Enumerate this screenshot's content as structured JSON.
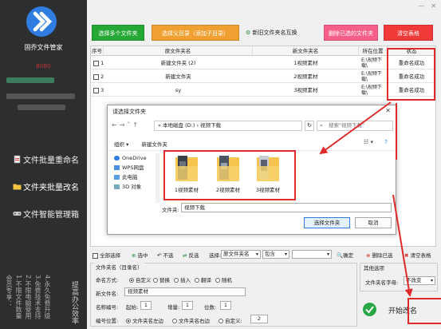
{
  "app": {
    "name": "固乔文件管家",
    "edition": "B0B0",
    "window_controls": [
      "—",
      "✕"
    ]
  },
  "sidebar": {
    "items": [
      {
        "label": "文件批量重命名",
        "icon": "document-icon"
      },
      {
        "label": "文件夹批量改名",
        "icon": "folder-icon"
      },
      {
        "label": "文件智能管理箱",
        "icon": "gamepad-icon"
      }
    ],
    "vertical_texts": [
      "会员专享：",
      "1.不限文件数量",
      "2.不限电脑使用",
      "3.免费技术支持",
      "4.永久免费升级",
      "提高办公效率"
    ]
  },
  "toolbar": {
    "add_folders": "选择多个文件夹",
    "add_parent": "选择父目录（添加子目录）",
    "new_name_swap": "新旧文件夹名互换",
    "delete_selected": "删除已选的文件夹",
    "clear_table": "清空表格",
    "colors": {
      "green": "#25a835",
      "orange": "#f0a030",
      "pink": "#f65f8a",
      "red": "#f03a3a"
    }
  },
  "grid": {
    "columns": [
      "序号",
      "原文件夹名",
      "新文件夹名",
      "所在位置",
      "状态"
    ],
    "rows": [
      {
        "index": "1",
        "original": "新建文件夹 (2)",
        "new_name": "1视频素材",
        "location": "E:\\视频下载\\",
        "status": "重命名成功"
      },
      {
        "index": "2",
        "original": "新建文件夹",
        "new_name": "2视频素材",
        "location": "E:\\视频下载\\",
        "status": "重命名成功"
      },
      {
        "index": "3",
        "original": "sy",
        "new_name": "3视频素材",
        "location": "E:\\视频下载\\",
        "status": "重命名成功"
      }
    ]
  },
  "dialog": {
    "title": "请选择文件夹",
    "address": "« 本地磁盘 (D:) › 视频下载",
    "search_placeholder": "搜索\"视频下载\"",
    "organize": "组织 ▾",
    "new_folder": "新建文件夹",
    "tree": [
      "OneDrive",
      "WPS网盘",
      "此电脑",
      "3D 对象"
    ],
    "folders": [
      "1视频素材",
      "2视频素材",
      "3视频素材"
    ],
    "filename_label": "文件夹:",
    "filename_value": "视频下载",
    "ok": "选择文件夹",
    "cancel": "取消"
  },
  "bottom_bar": {
    "select_all": "全部选择",
    "select": "选中",
    "unselect": "不选",
    "invert": "反选",
    "choose_label": "选择:",
    "choose_value": "原文件夹名",
    "contains": "包含",
    "confirm": "确定",
    "delete_selected": "删除已选",
    "clear_table": "清空表格"
  },
  "rename_panel": {
    "title": "文件夹名（目录名）",
    "mode_label": "命名方式:",
    "modes": [
      "自定义",
      "替换",
      "插入",
      "翻译",
      "随机"
    ],
    "new_name_label": "新文件名:",
    "new_name_value": "视频素材",
    "numbering_label": "名称编号:",
    "start_label": "起始:",
    "start_value": "1",
    "step_label": "增量:",
    "step_value": "1",
    "digits_label": "位数:",
    "digits_value": "1",
    "position_label": "编号位置:",
    "positions": [
      "文件夹名左边",
      "文件夹名右边",
      "自定义:"
    ],
    "custom_pos_value": "2"
  },
  "other": {
    "title": "其他选项",
    "label": "文件夹名字母:",
    "value": "不改变"
  },
  "start_button": "开始改名"
}
